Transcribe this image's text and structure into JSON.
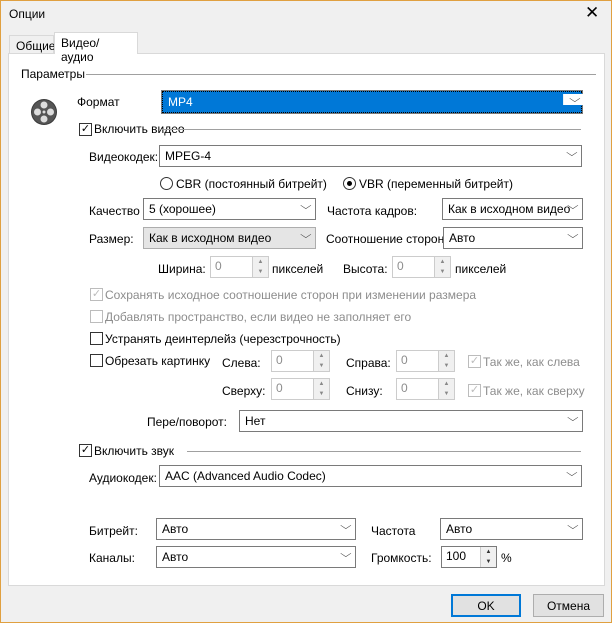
{
  "window": {
    "title": "Опции",
    "close_glyph": "✕"
  },
  "tabs": [
    {
      "label": "Общие"
    },
    {
      "label": "Видео/аудио"
    }
  ],
  "params": {
    "group": "Параметры",
    "format_label": "Формат",
    "format_value": "MP4"
  },
  "video": {
    "enable_label": "Включить видео",
    "enabled": true,
    "codec_label": "Видеокодек:",
    "codec_value": "MPEG-4",
    "cbr_label": "CBR (постоянный битрейт)",
    "vbr_label": "VBR (переменный битрейт)",
    "mode": "VBR",
    "quality_label": "Качество",
    "quality_value": "5 (хорошее)",
    "fps_label": "Частота кадров:",
    "fps_value": "Как в исходном видео",
    "size_label": "Размер:",
    "size_value": "Как в исходном видео",
    "aspect_label": "Соотношение сторон:",
    "aspect_value": "Авто",
    "width_label": "Ширина:",
    "width_value": "0",
    "height_label": "Высота:",
    "height_value": "0",
    "px_unit": "пикселей",
    "keep_aspect_label": "Сохранять исходное соотношение сторон при изменении размера",
    "keep_aspect": true,
    "pad_label": "Добавлять пространство, если видео не заполняет его",
    "pad": false,
    "deinterlace_label": "Устранять деинтерлейз (черезстрочность)",
    "deinterlace": false,
    "crop_label": "Обрезать картинку",
    "crop": false,
    "left_label": "Слева:",
    "left_value": "0",
    "right_label": "Справа:",
    "right_value": "0",
    "same_left_label": "Так же, как слева",
    "top_label": "Сверху:",
    "top_value": "0",
    "bottom_label": "Снизу:",
    "bottom_value": "0",
    "same_top_label": "Так же, как сверху",
    "rotate_label": "Пере/поворот:",
    "rotate_value": "Нет"
  },
  "audio": {
    "enable_label": "Включить звук",
    "enabled": true,
    "codec_label": "Аудиокодек:",
    "codec_value": "AAC (Advanced Audio Codec)",
    "bitrate_label": "Битрейт:",
    "bitrate_value": "Авто",
    "freq_label": "Частота",
    "freq_value": "Авто",
    "channels_label": "Каналы:",
    "channels_value": "Авто",
    "volume_label": "Громкость:",
    "volume_value": "100",
    "volume_unit": "%"
  },
  "buttons": {
    "ok": "OK",
    "cancel": "Отмена"
  }
}
